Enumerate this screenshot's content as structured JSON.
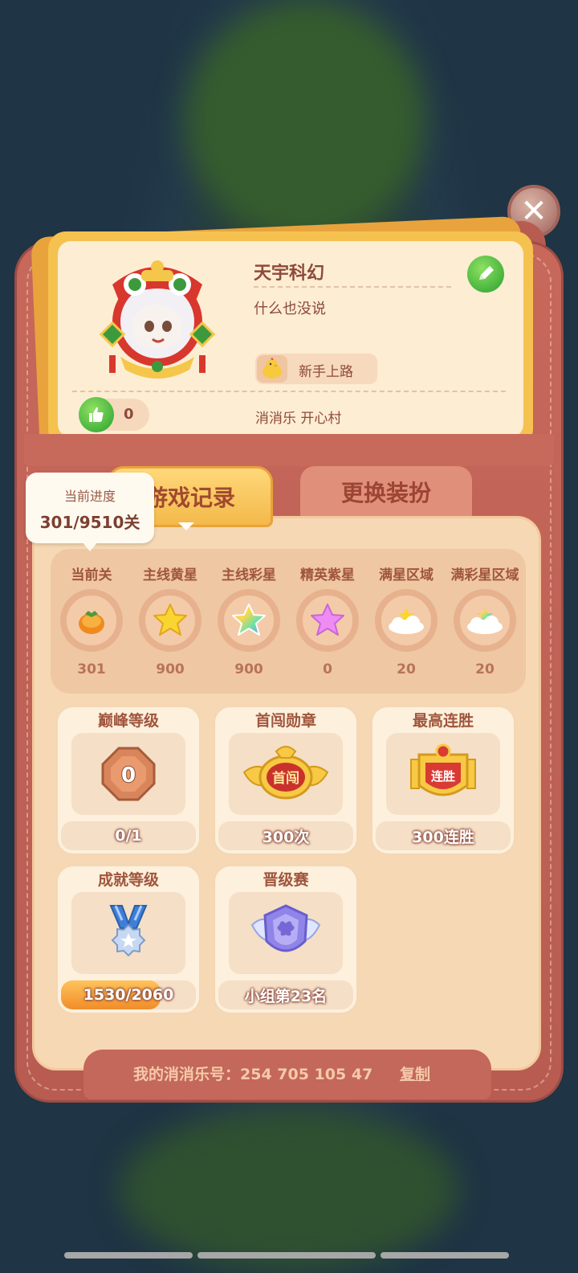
{
  "profile": {
    "name": "天宇科幻",
    "signature": "什么也没说",
    "rank_label": "新手上路",
    "likes": "0",
    "location": "消消乐  开心村"
  },
  "tabs": [
    {
      "label": "游戏记录",
      "active": true
    },
    {
      "label": "更换装扮",
      "active": false
    }
  ],
  "tooltip": {
    "title": "当前进度",
    "value": "301/9510关"
  },
  "stats": [
    {
      "label": "当前关",
      "value": "301",
      "icon": "persimmon-icon"
    },
    {
      "label": "主线黄星",
      "value": "900",
      "icon": "yellow-star-icon"
    },
    {
      "label": "主线彩星",
      "value": "900",
      "icon": "rainbow-star-icon"
    },
    {
      "label": "精英紫星",
      "value": "0",
      "icon": "purple-star-icon"
    },
    {
      "label": "满星区域",
      "value": "20",
      "icon": "cloud-star-icon"
    },
    {
      "label": "满彩星区域",
      "value": "20",
      "icon": "rainbow-cloud-icon"
    }
  ],
  "medals": {
    "peak": {
      "title": "巅峰等级",
      "value": "0/1",
      "badge": "0"
    },
    "first_pass": {
      "title": "首闯勋章",
      "value": "300次",
      "badge": "首闯"
    },
    "win_streak": {
      "title": "最高连胜",
      "value": "300连胜",
      "badge": "连胜"
    },
    "achievement": {
      "title": "成就等级",
      "value": "1530/2060",
      "progress": 0.74
    },
    "promotion": {
      "title": "晋级赛",
      "value": "小组第23名"
    }
  },
  "footer": {
    "account_text": "我的消消乐号：254 705 105 47",
    "copy_label": "复制"
  },
  "colors": {
    "wallet": "#c7685b",
    "panel": "#f6d8b4",
    "card_gold": "#f5c250",
    "text_brown": "#8d4a3b"
  }
}
